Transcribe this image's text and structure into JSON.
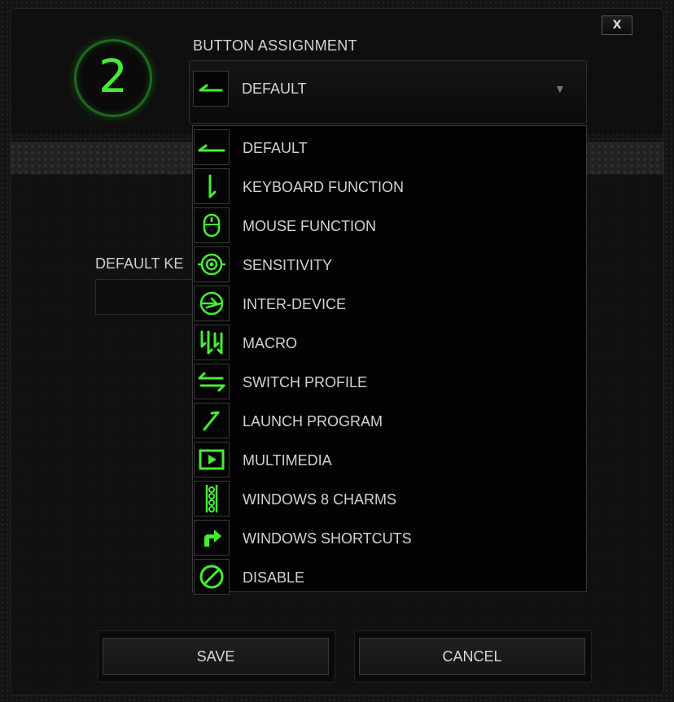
{
  "dialog": {
    "close_label": "X",
    "button_number": "2",
    "section_title": "BUTTON ASSIGNMENT",
    "accent_color": "#44ee33"
  },
  "select": {
    "value": "DEFAULT",
    "icon": "default-arrow-icon",
    "caret": "▼"
  },
  "dropdown": {
    "items": [
      {
        "label": "DEFAULT",
        "icon": "default-arrow-icon"
      },
      {
        "label": "KEYBOARD FUNCTION",
        "icon": "keyboard-function-icon"
      },
      {
        "label": "MOUSE FUNCTION",
        "icon": "mouse-icon"
      },
      {
        "label": "SENSITIVITY",
        "icon": "sensitivity-target-icon"
      },
      {
        "label": "INTER-DEVICE",
        "icon": "inter-device-icon"
      },
      {
        "label": "MACRO",
        "icon": "macro-icon"
      },
      {
        "label": "SWITCH PROFILE",
        "icon": "switch-profile-icon"
      },
      {
        "label": "LAUNCH PROGRAM",
        "icon": "launch-program-icon"
      },
      {
        "label": "MULTIMEDIA",
        "icon": "multimedia-play-icon"
      },
      {
        "label": "WINDOWS 8 CHARMS",
        "icon": "windows-charms-icon"
      },
      {
        "label": "WINDOWS SHORTCUTS",
        "icon": "windows-shortcut-icon"
      },
      {
        "label": "DISABLE",
        "icon": "disable-icon"
      }
    ]
  },
  "form": {
    "default_key_label": "DEFAULT KE",
    "default_key_value": ""
  },
  "footer": {
    "save_label": "SAVE",
    "cancel_label": "CANCEL"
  }
}
